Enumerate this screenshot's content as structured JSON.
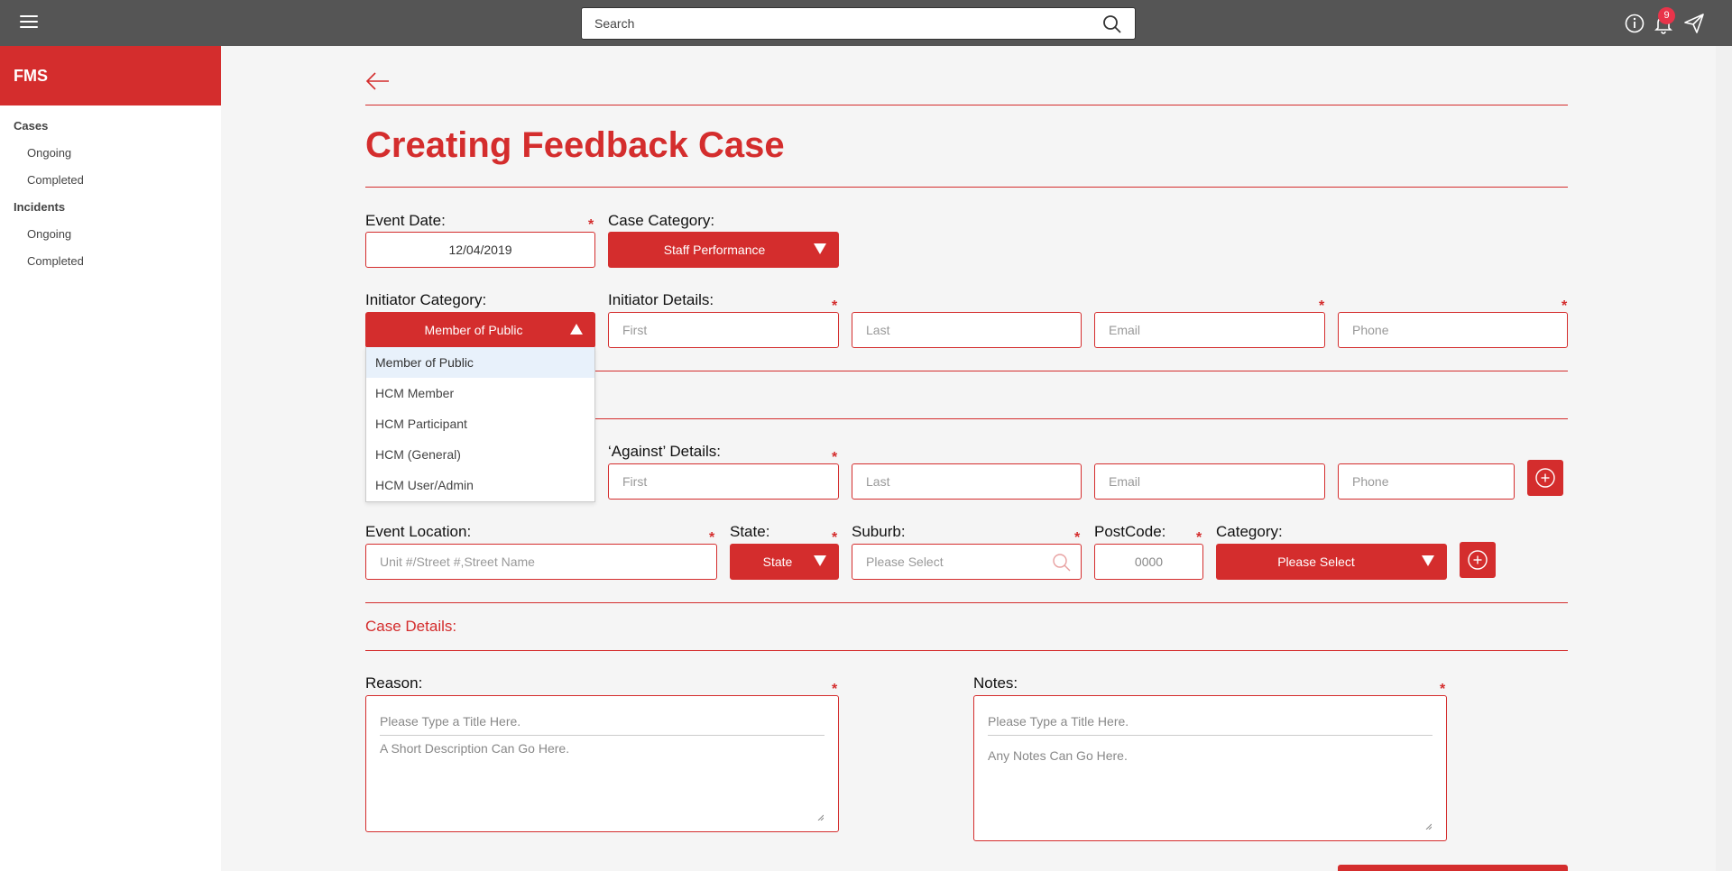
{
  "header": {
    "search_placeholder": "Search",
    "notification_count": "9"
  },
  "sidebar": {
    "brand": "FMS",
    "sections": [
      {
        "label": "Cases",
        "items": [
          "Ongoing",
          "Completed"
        ]
      },
      {
        "label": "Incidents",
        "items": [
          "Ongoing",
          "Completed"
        ]
      }
    ]
  },
  "page": {
    "title": "Creating Feedback Case"
  },
  "form": {
    "event_date_label": "Event Date:",
    "event_date_value": "12/04/2019",
    "case_category_label": "Case Category:",
    "case_category_value": "Staff Performance",
    "initiator_category_label": "Initiator Category:",
    "initiator_category_value": "Member of Public",
    "initiator_options": [
      "Member of Public",
      "HCM Member",
      "HCM Participant",
      "HCM (General)",
      "HCM User/Admin"
    ],
    "initiator_details_label": "Initiator Details:",
    "against_details_label": "‘Against’ Details:",
    "first_placeholder": "First",
    "last_placeholder": "Last",
    "email_placeholder": "Email",
    "phone_placeholder": "Phone",
    "event_location_label": "Event Location:",
    "event_location_placeholder": "Unit #/Street #,Street Name",
    "state_label": "State:",
    "state_value": "State",
    "suburb_label": "Suburb:",
    "suburb_placeholder": "Please Select",
    "postcode_label": "PostCode:",
    "postcode_placeholder": "0000",
    "category_label": "Category:",
    "category_value": "Please Select",
    "case_details_heading": "Case Details:",
    "reason_label": "Reason:",
    "reason_title_placeholder": "Please Type a Title Here.",
    "reason_desc_placeholder": "A Short Description Can Go Here.",
    "notes_label": "Notes:",
    "notes_title_placeholder": "Please Type a Title Here.",
    "notes_desc_placeholder": "Any Notes Can Go Here.",
    "required_mark": "*"
  },
  "colors": {
    "accent": "#d42d2d",
    "topbar": "#555555",
    "badge": "#e8344a",
    "background": "#f5f5f5"
  }
}
